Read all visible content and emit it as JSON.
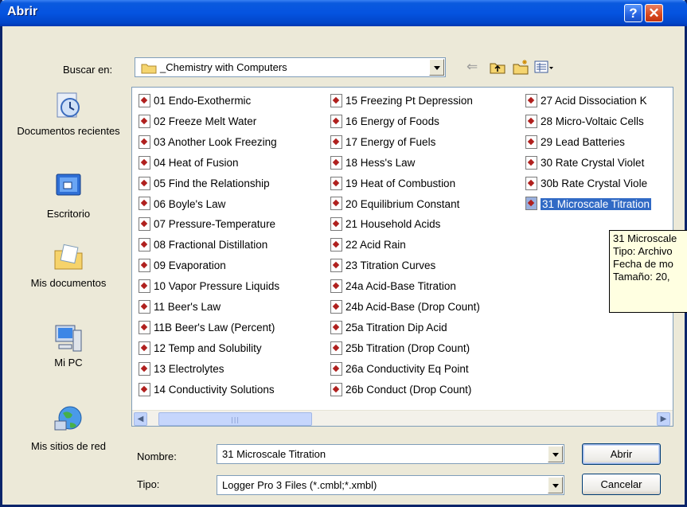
{
  "window": {
    "title": "Abrir",
    "help_glyph": "?",
    "close_glyph": "✕"
  },
  "look_in": {
    "label": "Buscar en:",
    "value": "_Chemistry with Computers"
  },
  "toolbar": {
    "icons": [
      "back-arrow-icon",
      "up-folder-icon",
      "new-folder-icon",
      "view-menu-icon"
    ]
  },
  "places": [
    {
      "label": "Documentos recientes",
      "icon": "recent-documents-icon"
    },
    {
      "label": "Escritorio",
      "icon": "desktop-icon"
    },
    {
      "label": "Mis documentos",
      "icon": "my-documents-icon"
    },
    {
      "label": "Mi PC",
      "icon": "my-computer-icon"
    },
    {
      "label": "Mis sitios de red",
      "icon": "network-places-icon"
    }
  ],
  "files": {
    "col1": [
      "01 Endo-Exothermic",
      "02 Freeze Melt Water",
      "03 Another Look Freezing",
      "04 Heat of Fusion",
      "05 Find the Relationship",
      "06 Boyle's Law",
      "07 Pressure-Temperature",
      "08 Fractional Distillation",
      "09 Evaporation",
      "10 Vapor Pressure Liquids",
      "11 Beer's Law",
      "11B Beer's Law (Percent)",
      "12 Temp and Solubility",
      "13 Electrolytes",
      "14 Conductivity Solutions"
    ],
    "col2": [
      "15 Freezing Pt Depression",
      "16 Energy of Foods",
      "17 Energy of Fuels",
      "18 Hess's Law",
      "19 Heat of Combustion",
      "20 Equilibrium Constant",
      "21 Household Acids",
      "22 Acid Rain",
      "23 Titration Curves",
      "24a Acid-Base Titration",
      "24b Acid-Base (Drop Count)",
      "25a Titration Dip Acid",
      "25b Titration (Drop Count)",
      "26a Conductivity Eq Point",
      "26b Conduct (Drop Count)"
    ],
    "col3": [
      "27 Acid Dissociation K",
      "28 Micro-Voltaic Cells",
      "29 Lead Batteries",
      "30 Rate Crystal Violet",
      "30b Rate Crystal Viole",
      "31 Microscale Titration"
    ],
    "selected": "31 Microscale Titration"
  },
  "tooltip": {
    "line1": "31 Microscale",
    "line2": "Tipo: Archivo",
    "line3": "Fecha de mo",
    "line4": "Tamaño: 20,"
  },
  "filename": {
    "label": "Nombre:",
    "value": "31 Microscale Titration"
  },
  "filetype": {
    "label": "Tipo:",
    "value": "Logger Pro 3 Files (*.cmbl;*.xmbl)"
  },
  "buttons": {
    "open": "Abrir",
    "cancel": "Cancelar"
  },
  "colors": {
    "title_bar": "#0553e0",
    "selection": "#316ac5",
    "dialog_bg": "#ece9d8",
    "tooltip_bg": "#ffffe1"
  }
}
